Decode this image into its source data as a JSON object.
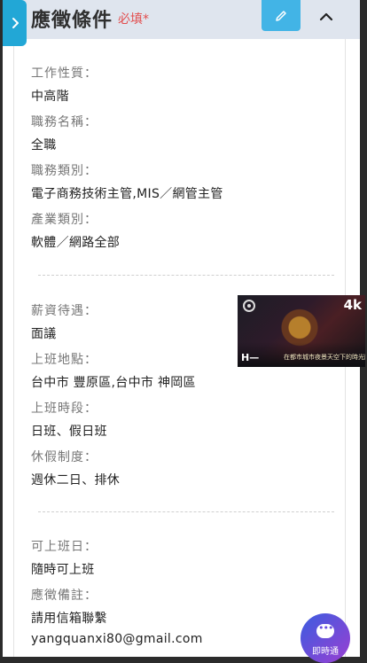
{
  "header": {
    "title": "應徵條件",
    "required": "必填*",
    "edit_icon": "pencil-icon",
    "collapse_icon": "chevron-up-icon",
    "side_tab_icon": "chevron-right-icon"
  },
  "group1": [
    {
      "label": "工作性質：",
      "value": "中高階"
    },
    {
      "label": "職務名稱：",
      "value": "全職"
    },
    {
      "label": "職務類別：",
      "value": "電子商務技術主管,MIS／網管主管"
    },
    {
      "label": "產業類別：",
      "value": "軟體／網路全部"
    }
  ],
  "group2": [
    {
      "label": "薪資待遇：",
      "value": "面議"
    },
    {
      "label": "上班地點：",
      "value": "台中市 豐原區,台中市 神岡區"
    },
    {
      "label": "上班時段：",
      "value": "日班、假日班"
    },
    {
      "label": "休假制度：",
      "value": "週休二日、排休"
    }
  ],
  "group3": [
    {
      "label": "可上班日：",
      "value": "隨時可上班"
    },
    {
      "label": "應徵備註：",
      "value": "請用信箱聯繫",
      "extra": "yangquanxi80@gmail.com"
    }
  ],
  "video": {
    "badge": "4k",
    "logo": "H—",
    "caption": "在都市城市夜景天空下的時光回憶"
  },
  "chat": {
    "label": "即時通",
    "icon": "chat-icon"
  },
  "colors": {
    "accent": "#42b4e6",
    "header_bg": "#dfe5ee",
    "required": "#e24d4d"
  }
}
